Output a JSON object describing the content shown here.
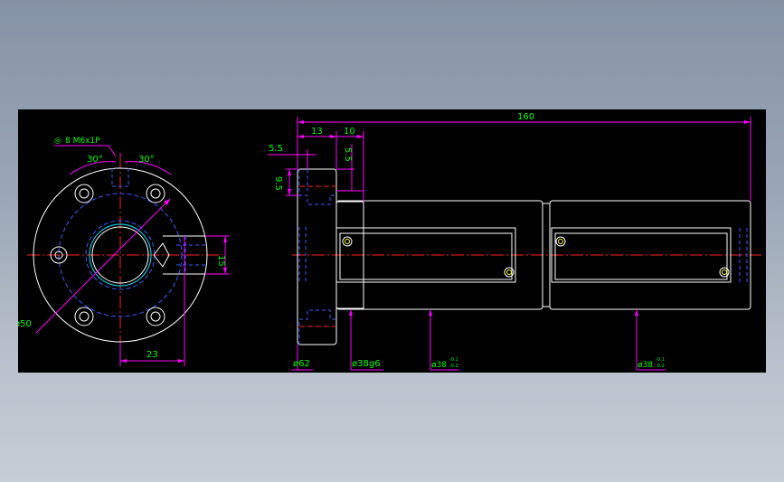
{
  "colors": {
    "background": "#000000",
    "outline": "#ffffff",
    "dimension": "#ff00ff",
    "text": "#00ff00",
    "hidden": "#3b5bff",
    "centerline": "#ff2020",
    "accent": "#00e5ff",
    "highlight": "#ffff00"
  },
  "front_view": {
    "callout": "8 M6x1P",
    "callout_marker": "◎",
    "angle_left": "30°",
    "angle_right": "30°",
    "dim_diameter": "ø50",
    "dim_bottom": "23",
    "dim_right": "15"
  },
  "side_view": {
    "dim_overall": "160",
    "dim_13": "13",
    "dim_10": "10",
    "dim_5_5_left": "5.5",
    "dim_5_5_vert": "5.5",
    "dim_9_5": "9.5",
    "dim_phi62": "ø62",
    "dim_phi38g6": "ø38g6",
    "dim_phi38_a": "ø38",
    "dim_phi38_b": "ø38",
    "tol_upper": "-0.1",
    "tol_lower": "-0.2"
  }
}
